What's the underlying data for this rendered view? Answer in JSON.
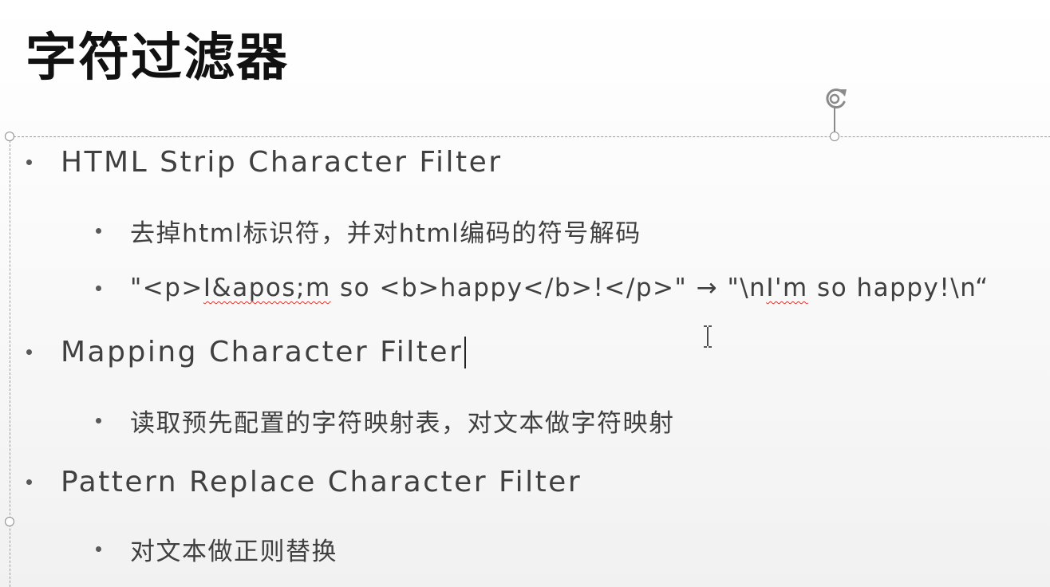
{
  "slide": {
    "title": "字符过滤器",
    "bullets": [
      {
        "label": "HTML Strip Character Filter",
        "children": [
          {
            "label": "去掉html标识符，并对html编码的符号解码"
          },
          {
            "prefix": "\"<p>",
            "misspelled_1": "I&apos;m",
            "middle": " so <b>happy</b>!</p>\" → \"\\n",
            "misspelled_2": "I'm",
            "suffix": " so happy!\\n“"
          }
        ]
      },
      {
        "label": "Mapping Character Filter",
        "children": [
          {
            "label": "读取预先配置的字符映射表，对文本做字符映射"
          }
        ]
      },
      {
        "label": "Pattern Replace Character Filter",
        "children": [
          {
            "label": "对文本做正则替换"
          }
        ]
      }
    ]
  },
  "icons": {
    "rotate": "rotate-handle-icon",
    "cursor": "text-ibeam-cursor-icon",
    "bullet": "bullet-dot-icon"
  },
  "colors": {
    "title": "#111111",
    "body_text": "#404040",
    "spellcheck_underline": "#e0342e",
    "selection_frame": "#9a9a9a"
  }
}
